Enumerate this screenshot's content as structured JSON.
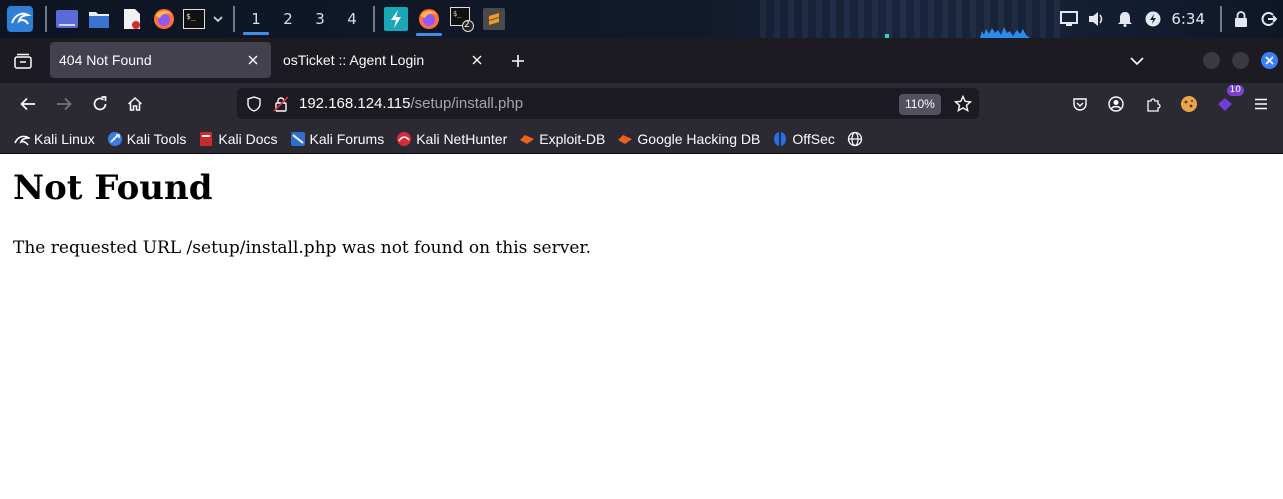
{
  "taskbar": {
    "workspaces": [
      "1",
      "2",
      "3",
      "4"
    ],
    "active_workspace": "1",
    "terminal_badge": "2",
    "clock": "6:34"
  },
  "browser": {
    "tabs": [
      {
        "title": "404 Not Found",
        "active": true
      },
      {
        "title": "osTicket :: Agent Login",
        "active": false
      }
    ],
    "url": {
      "host": "192.168.124.115",
      "path": "/setup/install.php"
    },
    "zoom": "110%",
    "extension_badge": "10",
    "bookmarks": [
      {
        "label": "Kali Linux",
        "icon": "kali-dragon-icon"
      },
      {
        "label": "Kali Tools",
        "icon": "kali-tools-icon"
      },
      {
        "label": "Kali Docs",
        "icon": "kali-docs-icon"
      },
      {
        "label": "Kali Forums",
        "icon": "kali-forums-icon"
      },
      {
        "label": "Kali NetHunter",
        "icon": "nethunter-icon"
      },
      {
        "label": "Exploit-DB",
        "icon": "exploit-db-icon"
      },
      {
        "label": "Google Hacking DB",
        "icon": "ghdb-icon"
      },
      {
        "label": "OffSec",
        "icon": "offsec-icon"
      }
    ]
  },
  "page": {
    "heading": "Not Found",
    "message": "The requested URL /setup/install.php was not found on this server."
  },
  "colors": {
    "accent": "#3f8ee8",
    "tab_active": "#42414d",
    "toolbar": "#2b2a33",
    "tabstrip": "#1c1b22"
  }
}
